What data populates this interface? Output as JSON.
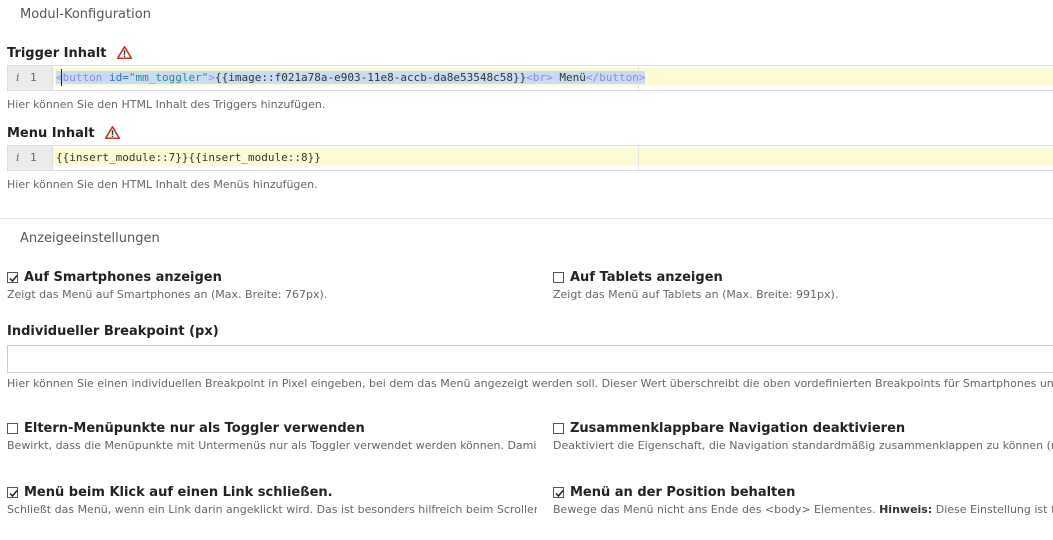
{
  "sections": {
    "module_config": "Modul-Konfiguration",
    "display_settings": "Anzeigeeinstellungen"
  },
  "trigger": {
    "label": "Trigger Inhalt",
    "line_number": "1",
    "code": {
      "open_tag": "<button ",
      "attr": "id=",
      "attr_value": "\"mm_toggler\"",
      "tag_close": ">",
      "insert_tag": "{{image::f021a78a-e903-11e8-accb-da8e53548c58}}",
      "br": "<br>",
      "text": " Menü",
      "end_tag": "</button>"
    },
    "help": "Hier können Sie den HTML Inhalt des Triggers hinzufügen."
  },
  "menu": {
    "label": "Menu Inhalt",
    "line_number": "1",
    "code": "{{insert_module::7}}{{insert_module::8}}",
    "help": "Hier können Sie den HTML Inhalt des Menüs hinzufügen."
  },
  "options": {
    "smartphones": {
      "label": "Auf Smartphones anzeigen",
      "help": "Zeigt das Menü auf Smartphones an (Max. Breite: 767px).",
      "checked": true
    },
    "tablets": {
      "label": "Auf Tablets anzeigen",
      "help": "Zeigt das Menü auf Tablets an (Max. Breite: 991px).",
      "checked": false
    },
    "breakpoint": {
      "label": "Individueller Breakpoint (px)",
      "value": "",
      "help": "Hier können Sie einen individuellen Breakpoint in Pixel eingeben, bei dem das Menü angezeigt werden soll. Dieser Wert überschreibt die oben vordefinierten Breakpoints für Smartphones und Tablets!"
    },
    "parent_toggler": {
      "label": "Eltern-Menüpunkte nur als Toggler verwenden",
      "help": "Bewirkt, dass die Menüpunkte mit Untermenüs nur als Toggler verwendet werden können. Damit",
      "checked": false
    },
    "disable_collapse": {
      "label": "Zusammenklappbare Navigation deaktivieren",
      "help": "Deaktiviert die Eigenschaft, die Navigation standardmäßig zusammenklappen zu können (nicht",
      "checked": false
    },
    "close_on_click": {
      "label": "Menü beim Klick auf einen Link schließen.",
      "help": "Schließt das Menü, wenn ein Link darin angeklickt wird. Das ist besonders hilfreich beim Scrollen",
      "checked": true
    },
    "keep_position": {
      "label": "Menü an der Position behalten",
      "help_pre": "Bewege das Menü nicht ans Ende des <body> Elementes. ",
      "help_bold": "Hinweis:",
      "help_post": " Diese Einstellung ist für",
      "checked": true
    }
  },
  "colors": {
    "warning": "#c0392b",
    "selection": "#c9dcf5",
    "active_line": "#fdfbd4"
  }
}
